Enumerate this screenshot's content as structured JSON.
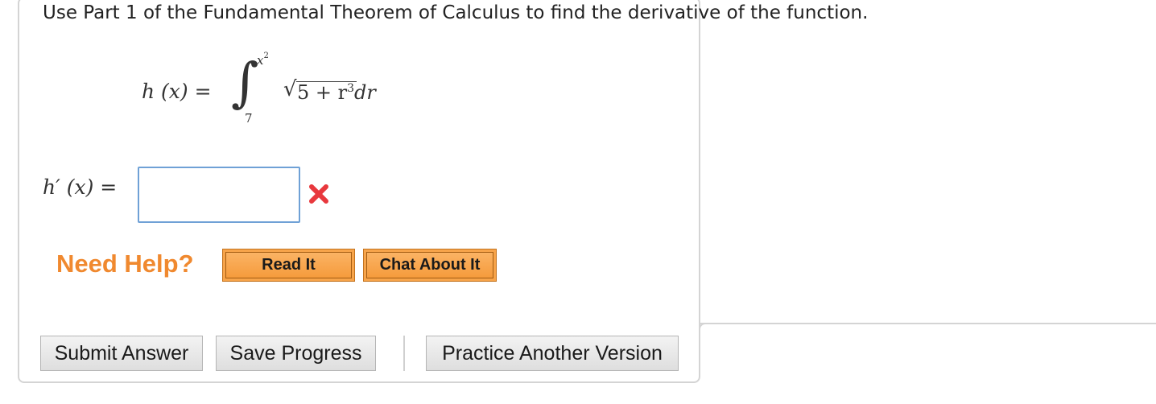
{
  "question": {
    "text": "Use Part 1 of the Fundamental Theorem of Calculus to find the derivative of the function."
  },
  "function": {
    "lhs": "h (x) =",
    "integral_symbol": "∫",
    "upper_limit_base": "x",
    "upper_limit_exponent": "2",
    "lower_limit": "7",
    "sqrt_symbol": "√",
    "integrand_lead": "5 + r",
    "integrand_exponent": "3",
    "integrand_tail": "dr"
  },
  "answer": {
    "label": "h′ (x) =",
    "value": "",
    "status_icon": "x-mark-icon",
    "status_color": "#e8383d"
  },
  "help": {
    "title": "Need Help?",
    "title_color": "#f0892f",
    "buttons": [
      {
        "label": "Read It"
      },
      {
        "label": "Chat About It"
      }
    ],
    "button_color": "#f7a44a"
  },
  "actions": {
    "submit_label": "Submit Answer",
    "save_label": "Save Progress",
    "practice_label": "Practice Another Version"
  }
}
